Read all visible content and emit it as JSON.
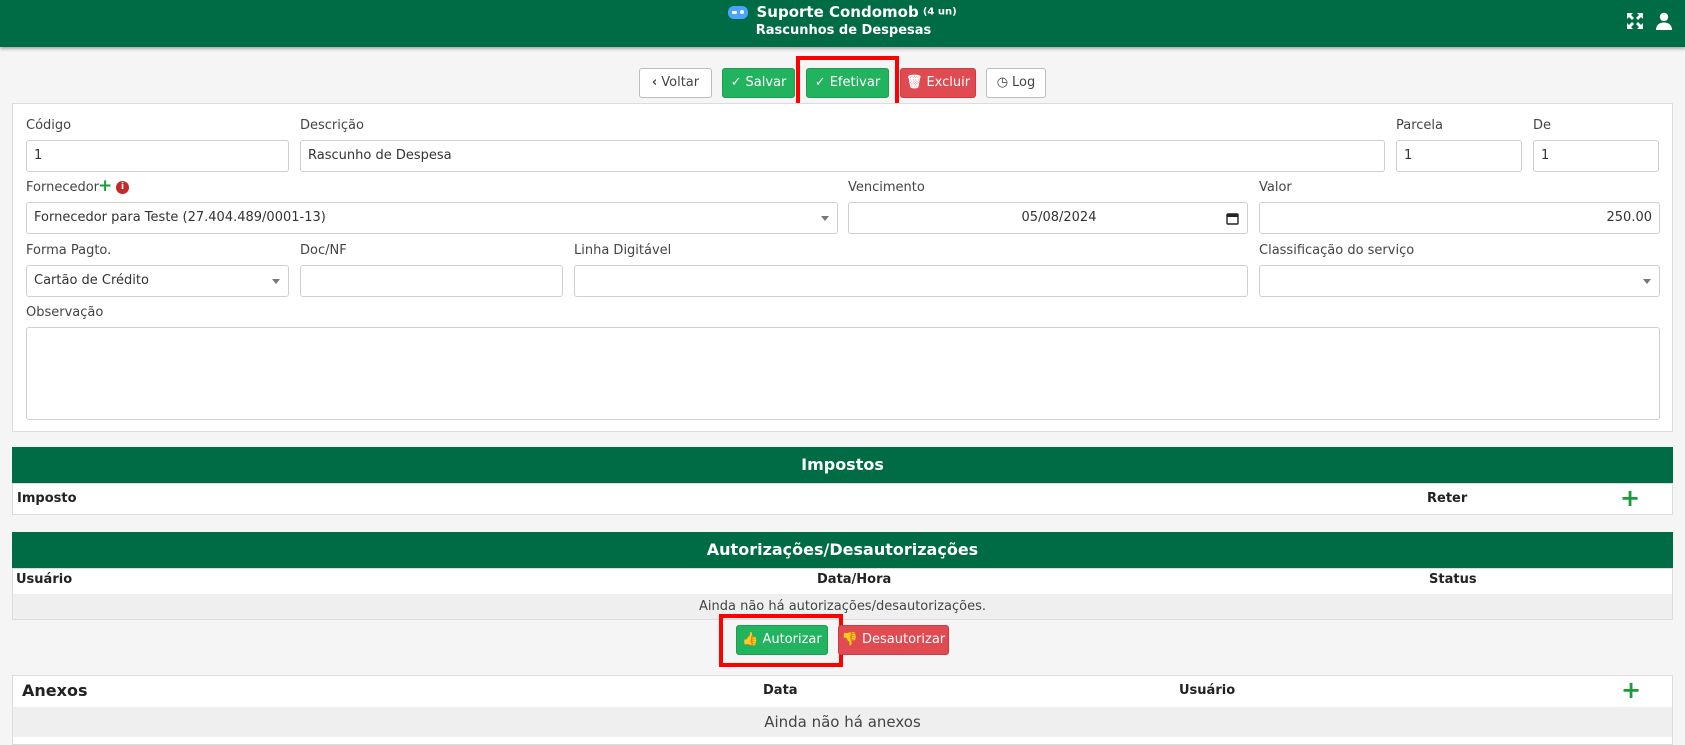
{
  "header": {
    "app_name": "Suporte Condomob",
    "unit_count": "(4 un)",
    "subtitle": "Rascunhos de Despesas",
    "accent_color": "#006c45",
    "icons": [
      "gamepad-icon",
      "fullscreen-icon",
      "user-icon"
    ]
  },
  "toolbar": {
    "back_label": "Voltar",
    "save_label": "Salvar",
    "effect_label": "Efetivar",
    "delete_label": "Excluir",
    "log_label": "Log"
  },
  "form": {
    "codigo": {
      "label": "Código",
      "value": "1"
    },
    "descricao": {
      "label": "Descrição",
      "value": "Rascunho de Despesa"
    },
    "parcela": {
      "label": "Parcela",
      "value": "1"
    },
    "de": {
      "label": "De",
      "value": "1"
    },
    "fornecedor": {
      "label": "Fornecedor",
      "value": "Fornecedor para Teste (27.404.489/0001-13)"
    },
    "vencimento": {
      "label": "Vencimento",
      "value": "05/08/2024"
    },
    "valor": {
      "label": "Valor",
      "value": "250.00"
    },
    "forma_pagto": {
      "label": "Forma Pagto.",
      "value": "Cartão de Crédito"
    },
    "doc_nf": {
      "label": "Doc/NF",
      "value": ""
    },
    "linha_digitavel": {
      "label": "Linha Digitável",
      "value": ""
    },
    "classificacao": {
      "label": "Classificação do serviço",
      "value": ""
    },
    "observacao": {
      "label": "Observação",
      "value": ""
    }
  },
  "impostos": {
    "title": "Impostos",
    "col_imposto": "Imposto",
    "col_reter": "Reter"
  },
  "autorizacoes": {
    "title": "Autorizações/Desautorizações",
    "col_usuario": "Usuário",
    "col_data_hora": "Data/Hora",
    "col_status": "Status",
    "empty": "Ainda não há autorizações/desautorizações.",
    "authorize_label": "Autorizar",
    "deauthorize_label": "Desautorizar"
  },
  "anexos": {
    "title": "Anexos",
    "col_data": "Data",
    "col_usuario": "Usuário",
    "empty": "Ainda não há anexos"
  }
}
